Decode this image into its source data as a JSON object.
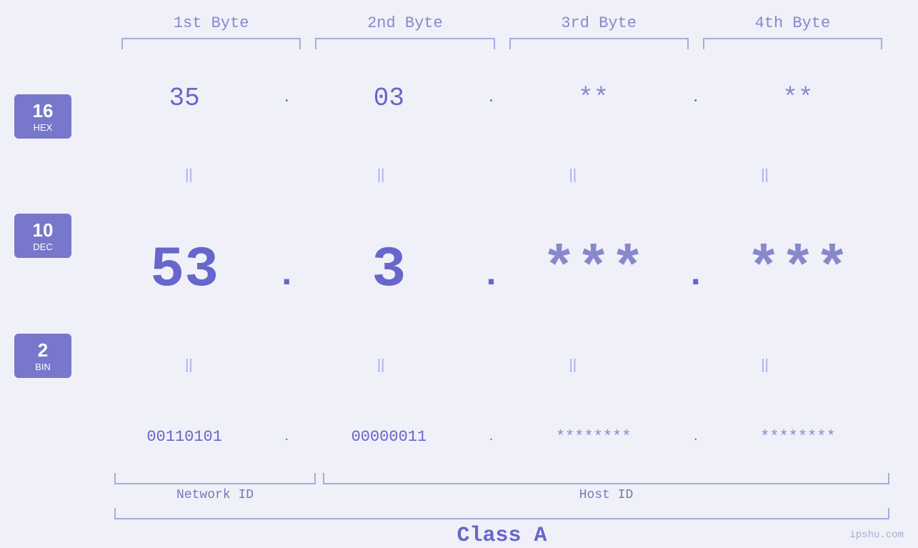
{
  "headers": {
    "byte1": "1st Byte",
    "byte2": "2nd Byte",
    "byte3": "3rd Byte",
    "byte4": "4th Byte"
  },
  "bases": {
    "hex": {
      "number": "16",
      "label": "HEX"
    },
    "dec": {
      "number": "10",
      "label": "DEC"
    },
    "bin": {
      "number": "2",
      "label": "BIN"
    }
  },
  "hex_row": {
    "b1": "35",
    "b2": "03",
    "b3": "**",
    "b4": "**",
    "dot": "."
  },
  "dec_row": {
    "b1": "53",
    "b2": "3",
    "b3": "***",
    "b4": "***",
    "dot": "."
  },
  "bin_row": {
    "b1": "00110101",
    "b2": "00000011",
    "b3": "********",
    "b4": "********",
    "dot": "."
  },
  "labels": {
    "network_id": "Network ID",
    "host_id": "Host ID",
    "class": "Class A"
  },
  "watermark": "ipshu.com"
}
